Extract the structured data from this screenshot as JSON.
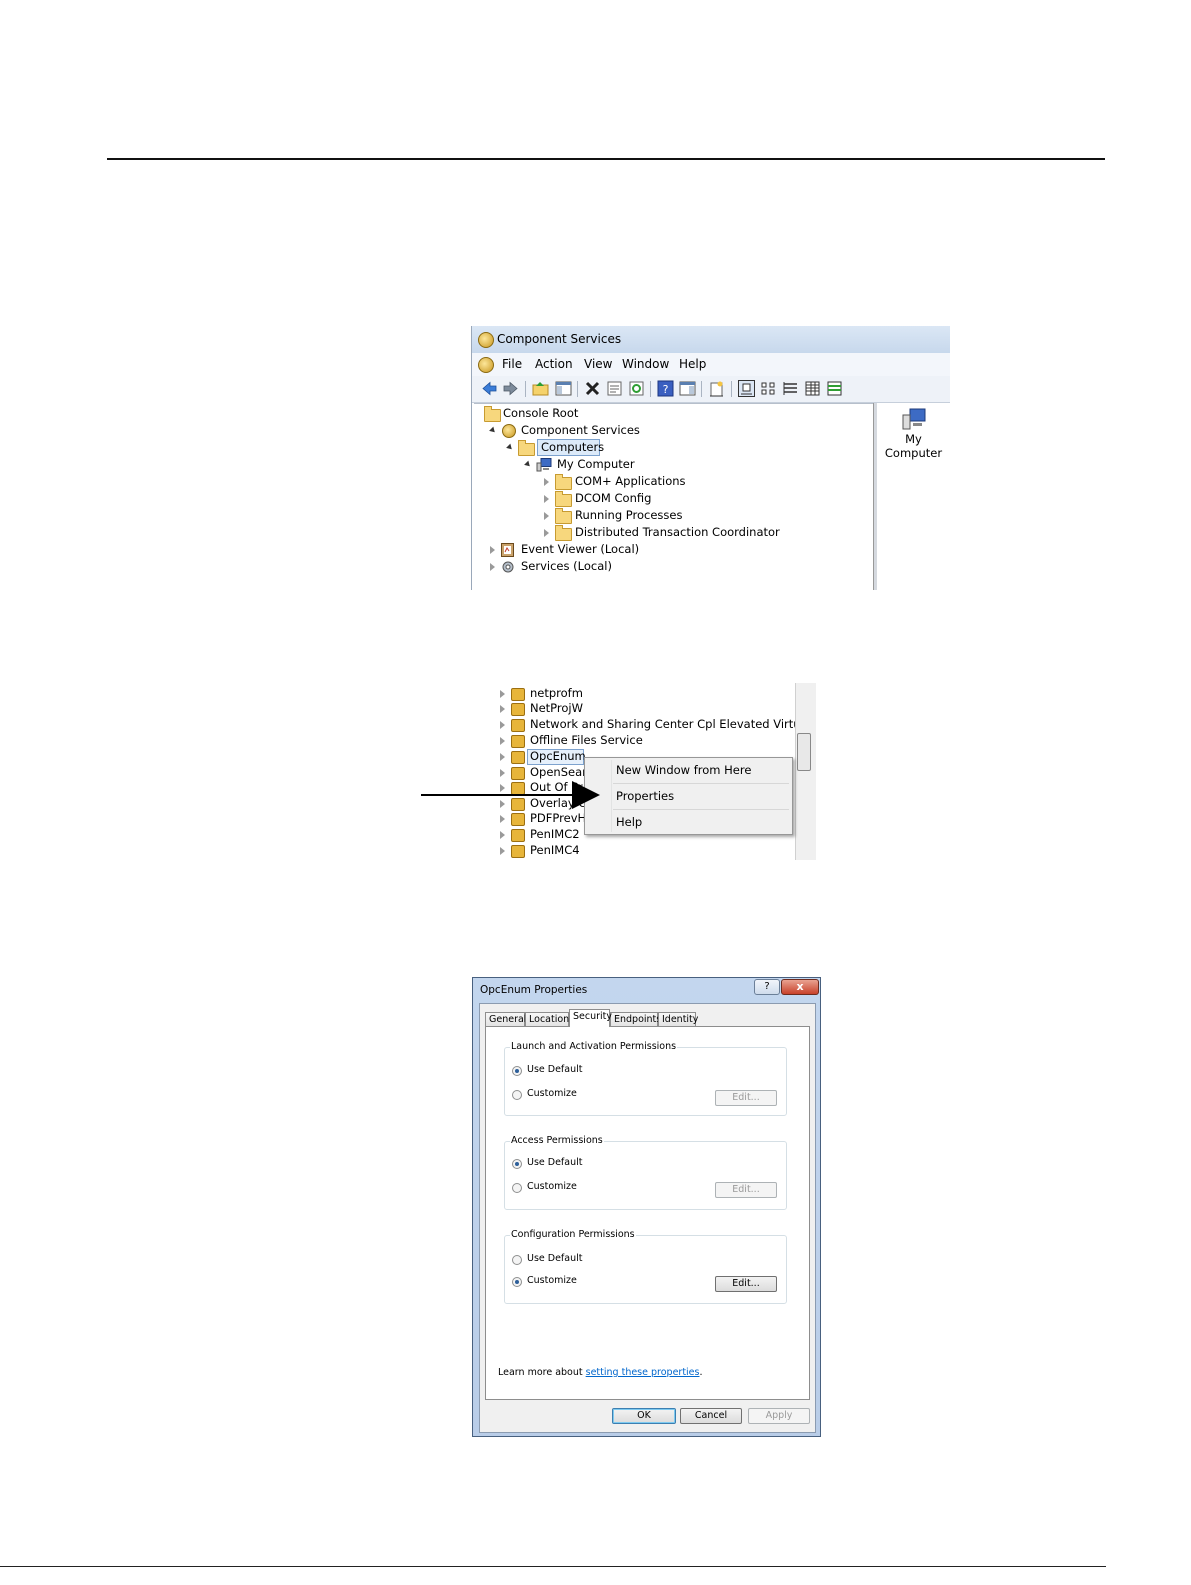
{
  "component_services": {
    "title": "Component Services",
    "menu": [
      "File",
      "Action",
      "View",
      "Window",
      "Help"
    ],
    "tree": [
      {
        "label": "Console Root"
      },
      {
        "label": "Component Services"
      },
      {
        "label": "Computers"
      },
      {
        "label": "My Computer"
      },
      {
        "label": "COM+ Applications"
      },
      {
        "label": "DCOM Config"
      },
      {
        "label": "Running Processes"
      },
      {
        "label": "Distributed Transaction Coordinator"
      },
      {
        "label": "Event Viewer (Local)"
      },
      {
        "label": "Services (Local)"
      }
    ],
    "right_pane_item": "My\nComputer"
  },
  "services_list": {
    "items": [
      "netprofm",
      "NetProjW",
      "Network and Sharing Center Cpl Elevated Virtual Fac",
      "Offline Files Service",
      "OpcEnum",
      "OpenSearc",
      "Out Of Pr",
      "Overlay Cl",
      "PDFPrevH",
      "PenIMC2",
      "PenIMC4"
    ],
    "selected": "OpcEnum"
  },
  "context_menu": {
    "items": [
      "New Window from Here",
      "Properties",
      "Help"
    ]
  },
  "dialog": {
    "title": "OpcEnum Properties",
    "help_button": "?",
    "close_button": "x",
    "tabs": [
      "General",
      "Location",
      "Security",
      "Endpoints",
      "Identity"
    ],
    "active_tab": "Security",
    "groups": [
      {
        "title": "Launch and Activation Permissions",
        "selected": "Use Default",
        "edit_enabled": false
      },
      {
        "title": "Access Permissions",
        "selected": "Use Default",
        "edit_enabled": false
      },
      {
        "title": "Configuration Permissions",
        "selected": "Customize",
        "edit_enabled": true
      }
    ],
    "option_use_default": "Use Default",
    "option_customize": "Customize",
    "edit_label": "Edit...",
    "learn_more_prefix": "Learn more about ",
    "learn_more_link": "setting these properties",
    "learn_more_suffix": ".",
    "ok_label": "OK",
    "cancel_label": "Cancel",
    "apply_label": "Apply"
  }
}
